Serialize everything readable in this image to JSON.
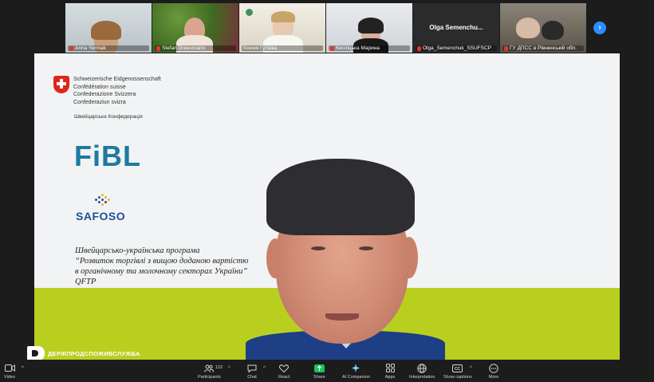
{
  "participants": [
    {
      "name": "Anna Yermak"
    },
    {
      "name": "Stefan Dreesmann"
    },
    {
      "name": "Ксенія Гутієва"
    },
    {
      "name": "Кисліцька Марина"
    },
    {
      "name": "Olga_Semenchuk_SSUFSCP",
      "display": "Olga Semenchu..."
    },
    {
      "name": "ГУ ДПСС в Рівненській обл."
    }
  ],
  "share": {
    "swiss_lines": [
      "Schweizerische Eidgenossenschaft",
      "Confédération suisse",
      "Confederazione Svizzera",
      "Confederaziun svizra"
    ],
    "swiss_ukr": "Швейцарська Конфедерація",
    "fibl": "FiBL",
    "safoso": "SAFOSO",
    "program_lines": [
      "Швейцарсько-українська програма",
      "“Розвиток торгівлі з вищою доданою вартістю",
      "в органічному та молочному секторах України”",
      "QFTP"
    ]
  },
  "speaker_logo": "ДЕРЖПРОДСПОЖИВСЛУЖБА",
  "toolbar": {
    "video": "Video",
    "participants": "Participants",
    "participants_count": "122",
    "chat": "Chat",
    "react": "React",
    "share": "Share",
    "ai": "AI Companion",
    "apps": "Apps",
    "interpretation": "Interpretation",
    "captions": "Show captions",
    "more": "More"
  },
  "colors": {
    "accent": "#2d8cff",
    "share_green": "#19c15c",
    "mic_red": "#e3352f",
    "lime_band": "#b9cf1f"
  }
}
